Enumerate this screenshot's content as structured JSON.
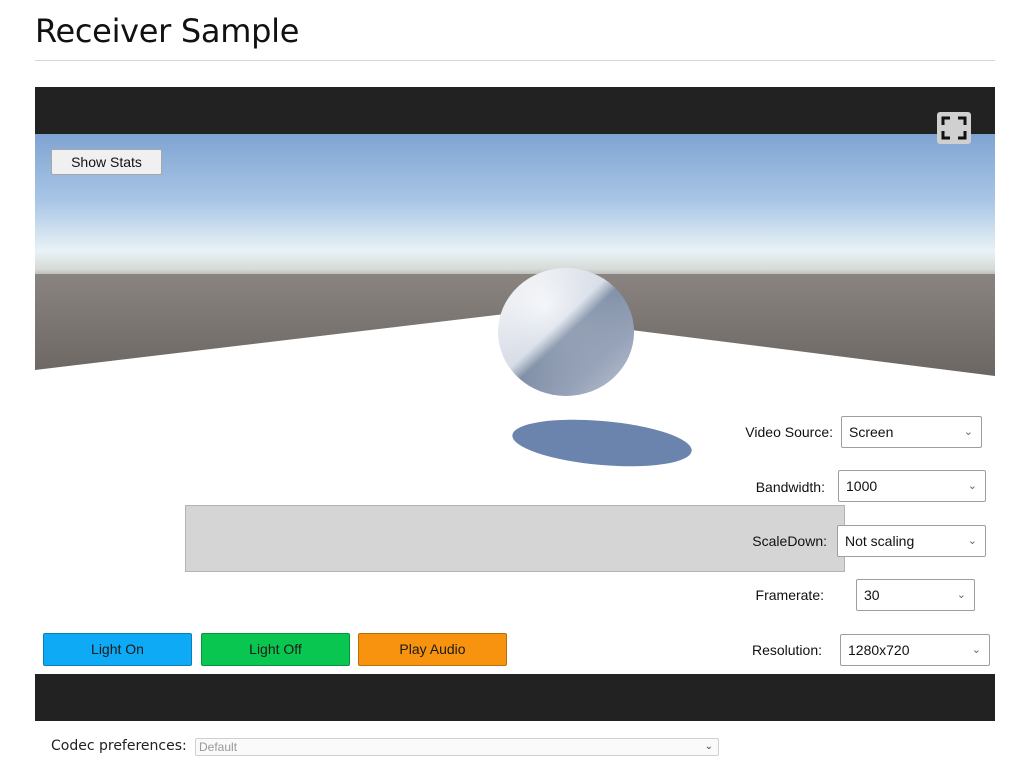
{
  "page": {
    "title": "Receiver Sample"
  },
  "player": {
    "show_stats_label": "Show Stats",
    "fullscreen_icon": "fullscreen-icon",
    "controls": {
      "video_source": {
        "label": "Video Source:",
        "value": "Screen"
      },
      "bandwidth": {
        "label": "Bandwidth:",
        "value": "1000"
      },
      "scale_down": {
        "label": "ScaleDown:",
        "value": "Not scaling"
      },
      "framerate": {
        "label": "Framerate:",
        "value": "30"
      },
      "resolution": {
        "label": "Resolution:",
        "value": "1280x720"
      }
    },
    "buttons": {
      "light_on": {
        "label": "Light On",
        "color": "#0eaaf5"
      },
      "light_off": {
        "label": "Light Off",
        "color": "#09c650"
      },
      "play_audio": {
        "label": "Play Audio",
        "color": "#f8930f"
      }
    }
  },
  "codec": {
    "label": "Codec preferences:",
    "value": "Default"
  },
  "colors": {
    "letterbox": "#222222",
    "panel_gray": "#d5d5d5"
  }
}
